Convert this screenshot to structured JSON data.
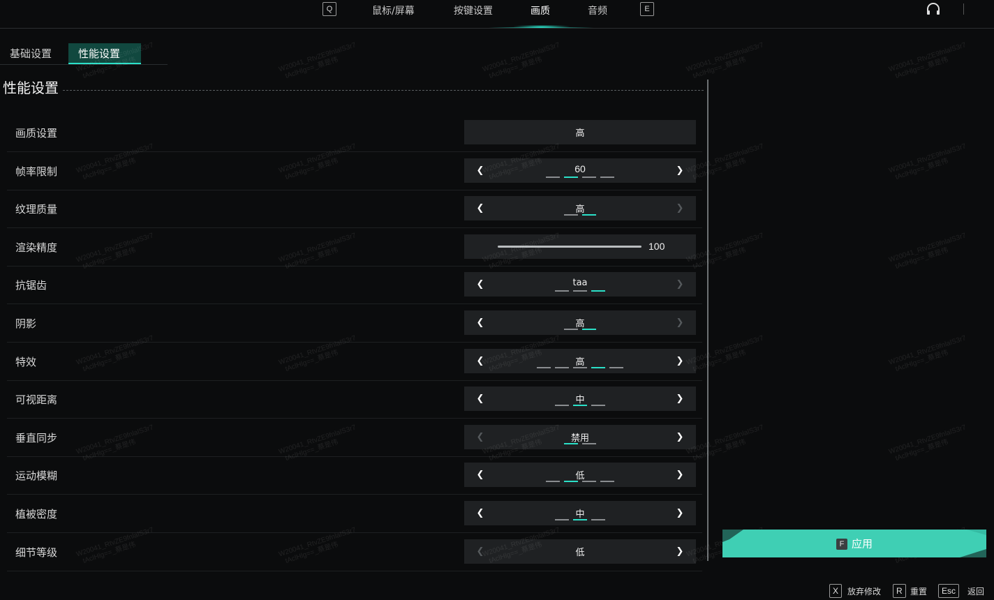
{
  "topbar": {
    "left_key": "Q",
    "right_key": "E",
    "tabs": [
      {
        "label": "鼠标/屏幕"
      },
      {
        "label": "按键设置"
      },
      {
        "label": "画质"
      },
      {
        "label": "音频"
      }
    ],
    "active_tab": "画质",
    "icons": [
      "headset-icon"
    ]
  },
  "subtabs": [
    {
      "label": "基础设置"
    },
    {
      "label": "性能设置"
    }
  ],
  "active_subtab": "性能设置",
  "page_title": "性能设置",
  "settings": [
    {
      "label": "画质设置",
      "type": "button",
      "value": "高"
    },
    {
      "label": "帧率限制",
      "type": "stepper",
      "value": "60",
      "options_count": 4,
      "selected_index": 1,
      "left_enabled": true,
      "right_enabled": true
    },
    {
      "label": "纹理质量",
      "type": "stepper",
      "value": "高",
      "options_count": 2,
      "selected_index": 1,
      "left_enabled": true,
      "right_enabled": false
    },
    {
      "label": "渲染精度",
      "type": "slider",
      "value": "100",
      "level": 1.0
    },
    {
      "label": "抗锯齿",
      "type": "stepper",
      "value": "taa",
      "options_count": 3,
      "selected_index": 2,
      "left_enabled": true,
      "right_enabled": false
    },
    {
      "label": "阴影",
      "type": "stepper",
      "value": "高",
      "options_count": 2,
      "selected_index": 1,
      "left_enabled": true,
      "right_enabled": false
    },
    {
      "label": "特效",
      "type": "stepper",
      "value": "高",
      "options_count": 5,
      "selected_index": 3,
      "left_enabled": true,
      "right_enabled": true
    },
    {
      "label": "可视距离",
      "type": "stepper",
      "value": "中",
      "options_count": 3,
      "selected_index": 1,
      "left_enabled": true,
      "right_enabled": true
    },
    {
      "label": "垂直同步",
      "type": "stepper",
      "value": "禁用",
      "options_count": 2,
      "selected_index": 0,
      "left_enabled": false,
      "right_enabled": true
    },
    {
      "label": "运动模糊",
      "type": "stepper",
      "value": "低",
      "options_count": 4,
      "selected_index": 1,
      "left_enabled": true,
      "right_enabled": true
    },
    {
      "label": "植被密度",
      "type": "stepper",
      "value": "中",
      "options_count": 3,
      "selected_index": 1,
      "left_enabled": true,
      "right_enabled": true
    },
    {
      "label": "细节等级",
      "type": "stepper",
      "value": "低",
      "options_count": 0,
      "selected_index": 0,
      "left_enabled": false,
      "right_enabled": true
    }
  ],
  "watermark": {
    "line1": "W20041_RtvZE9fnlalS3r7",
    "line2": "tAclHlg==_蔡是伟"
  },
  "apply": {
    "key": "F",
    "label": "应用"
  },
  "footer": [
    {
      "key": "X",
      "label": "放弃修改"
    },
    {
      "key": "R",
      "label": "重置"
    },
    {
      "key": "Esc",
      "label": "返回"
    }
  ],
  "colors": {
    "accent": "#2be0c8",
    "apply_bg": "#3fcfb4",
    "background": "#0b0c0d",
    "control_bg": "#1f2123"
  }
}
